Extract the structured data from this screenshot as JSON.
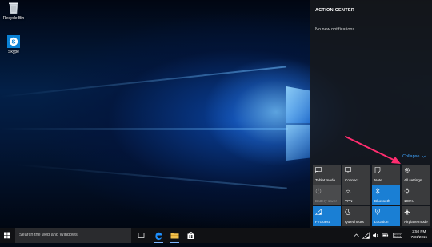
{
  "desktop": {
    "icons": [
      {
        "label": "Recycle Bin",
        "icon": "recycle-bin-icon"
      },
      {
        "label": "Skype",
        "icon": "skype-icon"
      }
    ]
  },
  "action_center": {
    "title": "ACTION CENTER",
    "empty_message": "No new notifications",
    "collapse_label": "Collapse",
    "tiles": [
      {
        "label": "Tablet mode",
        "icon": "tablet-mode-icon",
        "state": "off"
      },
      {
        "label": "Connect",
        "icon": "connect-icon",
        "state": "off"
      },
      {
        "label": "Note",
        "icon": "note-icon",
        "state": "off"
      },
      {
        "label": "All settings",
        "icon": "gear-icon",
        "state": "off"
      },
      {
        "label": "Battery saver",
        "icon": "battery-saver-icon",
        "state": "disabled"
      },
      {
        "label": "VPN",
        "icon": "vpn-icon",
        "state": "off"
      },
      {
        "label": "Bluetooth",
        "icon": "bluetooth-icon",
        "state": "on"
      },
      {
        "label": "100%",
        "icon": "brightness-icon",
        "state": "off"
      },
      {
        "label": "FTGuest",
        "icon": "wifi-icon",
        "state": "on"
      },
      {
        "label": "Quiet hours",
        "icon": "moon-icon",
        "state": "off"
      },
      {
        "label": "Location",
        "icon": "location-icon",
        "state": "on"
      },
      {
        "label": "Airplane mode",
        "icon": "airplane-icon",
        "state": "off"
      }
    ],
    "accent_color": "#1a7fd4",
    "annotation_color": "#ff2d6f"
  },
  "taskbar": {
    "search_placeholder": "Search the web and Windows",
    "pinned": [
      "task-view-icon",
      "edge-icon",
      "file-explorer-icon",
      "store-icon"
    ],
    "clock": {
      "time": "2:50 PM",
      "date": "7/31/2015"
    }
  }
}
